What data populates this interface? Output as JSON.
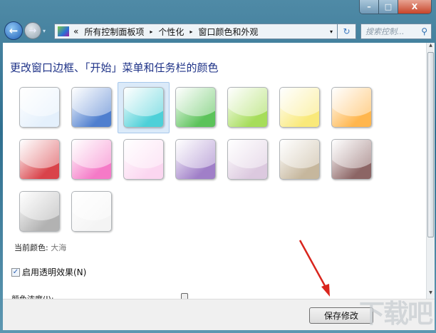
{
  "window": {
    "minimize": "–",
    "maximize": "□",
    "close": "X"
  },
  "nav": {
    "back": "←",
    "forward": "→",
    "dropdown": "▾"
  },
  "address": {
    "prefix": "«",
    "crumbs": [
      "所有控制面板项",
      "个性化",
      "窗口颜色和外观"
    ],
    "separator": "▸",
    "dropdown": "▾"
  },
  "refresh": "↻",
  "search": {
    "placeholder": "搜索控制...",
    "icon": "search-icon"
  },
  "main": {
    "title": "更改窗口边框、「开始」菜单和任务栏的颜色",
    "swatches": [
      {
        "name": "sky",
        "color": "#e4f0fc"
      },
      {
        "name": "twilight",
        "color": "#4f7fcf"
      },
      {
        "name": "sea",
        "color": "#4dd0d8",
        "selected": true
      },
      {
        "name": "leaf",
        "color": "#5cc35a"
      },
      {
        "name": "lime",
        "color": "#a6dd5a"
      },
      {
        "name": "lemon",
        "color": "#f9e97a"
      },
      {
        "name": "orange",
        "color": "#ffb64d"
      },
      {
        "name": "ruby",
        "color": "#d9434a"
      },
      {
        "name": "fuchsia",
        "color": "#f57ac7"
      },
      {
        "name": "blush",
        "color": "#fbd6f0"
      },
      {
        "name": "violet",
        "color": "#a07fc8"
      },
      {
        "name": "lavender",
        "color": "#dcc9df"
      },
      {
        "name": "taupe",
        "color": "#c6b79d"
      },
      {
        "name": "chocolate",
        "color": "#8c6565"
      },
      {
        "name": "slate",
        "color": "#b2b2b2"
      },
      {
        "name": "frost",
        "color": "#f4f4f4"
      }
    ],
    "current_label": "当前颜色:",
    "current_value": "大海",
    "transparency_label": "启用透明效果(N)",
    "transparency_checked": true,
    "intensity_label": "颜色浓度(I):"
  },
  "footer": {
    "save_label": "保存修改"
  },
  "watermark": "下载吧",
  "colors": {
    "accent": "#1e3287",
    "arrow": "#d9251d"
  }
}
